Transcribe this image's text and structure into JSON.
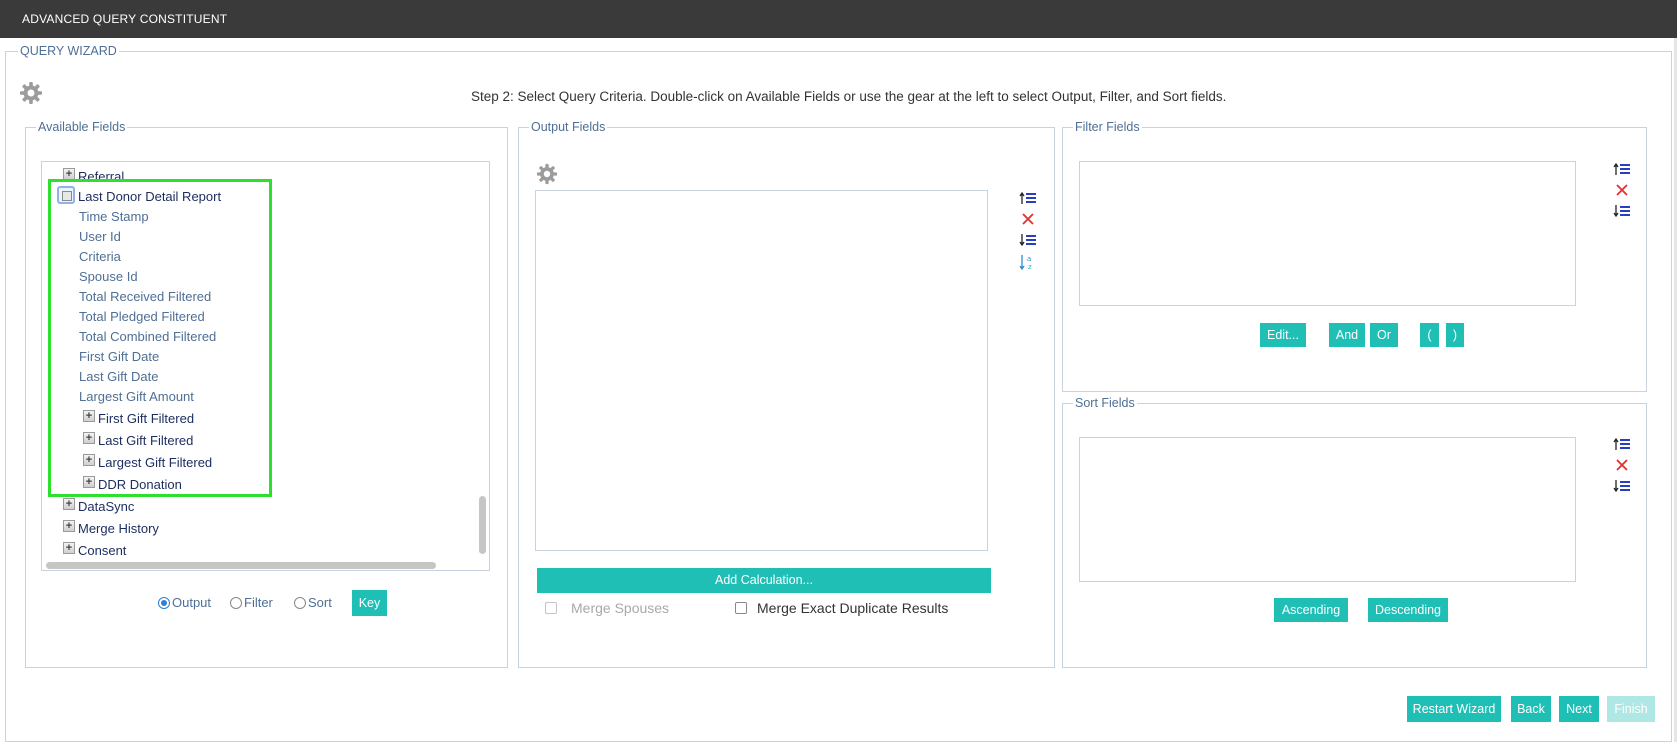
{
  "window": {
    "title": "ADVANCED QUERY CONSTITUENT"
  },
  "wizard": {
    "legend": "QUERY WIZARD",
    "instruction": "Step 2: Select Query Criteria. Double-click on Available Fields or use the gear at the left to select Output, Filter, and Sort fields."
  },
  "available": {
    "legend": "Available Fields",
    "tree": [
      {
        "label": "Referral",
        "type": "folder"
      },
      {
        "label": "Last Donor Detail Report",
        "type": "folder",
        "expanded": true
      },
      {
        "label": "Time Stamp",
        "type": "field"
      },
      {
        "label": "User Id",
        "type": "field"
      },
      {
        "label": "Criteria",
        "type": "field"
      },
      {
        "label": "Spouse Id",
        "type": "field"
      },
      {
        "label": "Total Received Filtered",
        "type": "field"
      },
      {
        "label": "Total Pledged Filtered",
        "type": "field"
      },
      {
        "label": "Total Combined Filtered",
        "type": "field"
      },
      {
        "label": "First Gift Date",
        "type": "field"
      },
      {
        "label": "Last Gift Date",
        "type": "field"
      },
      {
        "label": "Largest Gift Amount",
        "type": "field"
      },
      {
        "label": "First Gift Filtered",
        "type": "subfolder"
      },
      {
        "label": "Last Gift Filtered",
        "type": "subfolder"
      },
      {
        "label": "Largest Gift Filtered",
        "type": "subfolder"
      },
      {
        "label": "DDR Donation",
        "type": "subfolder"
      },
      {
        "label": "DataSync",
        "type": "folder"
      },
      {
        "label": "Merge History",
        "type": "folder"
      },
      {
        "label": "Consent",
        "type": "folder"
      }
    ],
    "modes": {
      "output": "Output",
      "filter": "Filter",
      "sort": "Sort",
      "selected": "Output"
    },
    "key_button": "Key"
  },
  "output": {
    "legend": "Output Fields",
    "add_calculation": "Add Calculation...",
    "merge_spouses": "Merge Spouses",
    "merge_duplicates": "Merge Exact Duplicate Results"
  },
  "filter": {
    "legend": "Filter Fields",
    "edit": "Edit...",
    "and": "And",
    "or": "Or",
    "open_paren": "(",
    "close_paren": ")"
  },
  "sort": {
    "legend": "Sort Fields",
    "ascending": "Ascending",
    "descending": "Descending"
  },
  "footer": {
    "restart": "Restart Wizard",
    "back": "Back",
    "next": "Next",
    "finish": "Finish"
  },
  "colors": {
    "accent": "#1fbfb6",
    "titlebar": "#3a3a3a",
    "highlight": "#2ee02e",
    "delete": "#e03030",
    "list_icon": "#2a3fbf"
  }
}
